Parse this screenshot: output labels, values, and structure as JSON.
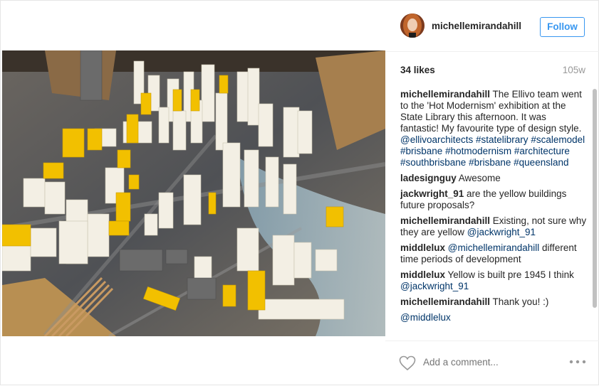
{
  "post": {
    "username": "michellemirandahill",
    "follow_label": "Follow",
    "likes": "34 likes",
    "age": "105w"
  },
  "comments": [
    {
      "user": "michellemirandahill",
      "segments": [
        {
          "t": " The Ellivo team went to the 'Hot Modernism' exhibition at the State Library this afternoon. It was fantastic! My favourite type of design style. ",
          "link": false
        },
        {
          "t": "@ellivoarchitects",
          "link": true
        },
        {
          "t": " ",
          "link": false
        },
        {
          "t": "#statelibrary",
          "link": true
        },
        {
          "t": " ",
          "link": false
        },
        {
          "t": "#scalemodel",
          "link": true
        },
        {
          "t": " ",
          "link": false
        },
        {
          "t": "#brisbane",
          "link": true
        },
        {
          "t": " ",
          "link": false
        },
        {
          "t": "#hotmodernism",
          "link": true
        },
        {
          "t": " ",
          "link": false
        },
        {
          "t": "#architecture",
          "link": true
        },
        {
          "t": " ",
          "link": false
        },
        {
          "t": "#southbrisbane",
          "link": true
        },
        {
          "t": " ",
          "link": false
        },
        {
          "t": "#brisbane",
          "link": true
        },
        {
          "t": " ",
          "link": false
        },
        {
          "t": "#queensland",
          "link": true
        }
      ]
    },
    {
      "user": "ladesignguy",
      "segments": [
        {
          "t": " Awesome",
          "link": false
        }
      ]
    },
    {
      "user": "jackwright_91",
      "segments": [
        {
          "t": " are the yellow buildings future proposals?",
          "link": false
        }
      ]
    },
    {
      "user": "michellemirandahill",
      "segments": [
        {
          "t": " Existing, not sure why they are yellow ",
          "link": false
        },
        {
          "t": "@jackwright_91",
          "link": true
        }
      ]
    },
    {
      "user": "middlelux",
      "segments": [
        {
          "t": " ",
          "link": false
        },
        {
          "t": "@michellemirandahill",
          "link": true
        },
        {
          "t": " different time periods of development",
          "link": false
        }
      ]
    },
    {
      "user": "middlelux",
      "segments": [
        {
          "t": " Yellow is built pre 1945 I think ",
          "link": false
        },
        {
          "t": "@jackwright_91",
          "link": true
        }
      ]
    },
    {
      "user": "michellemirandahill",
      "segments": [
        {
          "t": " Thank you! :)",
          "link": false
        }
      ]
    },
    {
      "user": "",
      "segments": [
        {
          "t": "@middlelux",
          "link": true
        }
      ]
    }
  ],
  "footer": {
    "comment_placeholder": "Add a comment..."
  },
  "colors": {
    "link": "#003569",
    "follow_blue": "#3897f0",
    "building_yellow": "#f2c000",
    "building_white": "#f3efe4"
  },
  "icons": {
    "like": "heart-outline-icon",
    "options": "more-options-icon"
  }
}
